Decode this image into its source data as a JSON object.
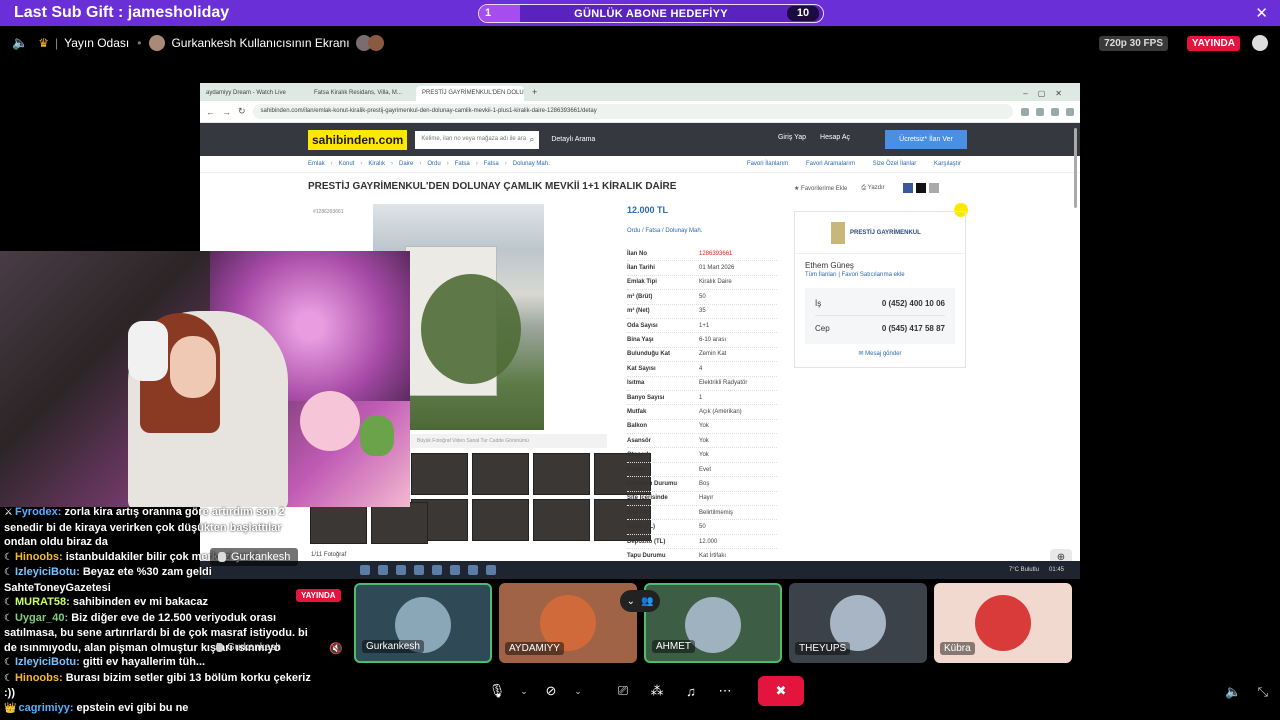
{
  "gift": {
    "title": "Last Sub Gift : jamesholiday",
    "goal_start": "1",
    "goal_label": "GÜNLÜK ABONE HEDEFİYY",
    "goal_end": "10",
    "goal_progress": 0.12
  },
  "room": {
    "name": "Yayın Odası",
    "screen_owner": "Gurkankesh Kullanıcısının Ekranı",
    "resolution": "720p 30 FPS",
    "live": "YAYINDA"
  },
  "browser": {
    "tabs": [
      "aydamiyy Dream - Watch Live",
      "Fatsa Kiralık Residans, Villa, M...",
      "PRESTİJ GAYRİMENKUL'DEN DOLU..."
    ],
    "url": "sahibinden.com/ilan/emlak-konut-kiralik-prestij-gayrimenkul-den-dolunay-camlik-mevkii-1-plus1-kiralik-daire-1286393661/detay"
  },
  "site": {
    "logo": "sahibinden.com",
    "search_placeholder": "Kelime, ilan no veya mağaza adı ile ara",
    "advanced": "Detaylı Arama",
    "login": "Giriş Yap",
    "register": "Hesap Aç",
    "cta": "Ücretsiz* İlan Ver",
    "crumbs": [
      "Emlak",
      "Konut",
      "Kiralık",
      "Daire",
      "Ordu",
      "Fatsa",
      "Fatsa",
      "Dolunay Mah."
    ],
    "crumb_right": [
      "Favori İlanlarım",
      "Favori Aramalarım",
      "Size Özel İlanlar",
      "Karşılaştır"
    ]
  },
  "listing": {
    "title": "PRESTİJ GAYRİMENKUL'DEN DOLUNAY ÇAMLIK MEVKİİ 1+1 KİRALIK DAİRE",
    "fav": "Favorilerime Ekle",
    "print": "Yazdır",
    "listing_no_small": "#1286393661",
    "photo_count": "1/11 Fotoğraf",
    "photo_tools": "Büyük Fotoğraf    Video    Sanal Tur    Cadde Görünümü",
    "price": "12.000 TL",
    "location": "Ordu  /  Fatsa  /  Dolunay Mah.",
    "attributes": [
      {
        "k": "İlan No",
        "v": "1286393661",
        "red": true
      },
      {
        "k": "İlan Tarihi",
        "v": "01 Mart 2026"
      },
      {
        "k": "Emlak Tipi",
        "v": "Kiralık Daire"
      },
      {
        "k": "m² (Brüt)",
        "v": "50"
      },
      {
        "k": "m² (Net)",
        "v": "35"
      },
      {
        "k": "Oda Sayısı",
        "v": "1+1"
      },
      {
        "k": "Bina Yaşı",
        "v": "6-10 arası"
      },
      {
        "k": "Bulunduğu Kat",
        "v": "Zemin Kat"
      },
      {
        "k": "Kat Sayısı",
        "v": "4"
      },
      {
        "k": "Isıtma",
        "v": "Elektrikli Radyatör"
      },
      {
        "k": "Banyo Sayısı",
        "v": "1"
      },
      {
        "k": "Mutfak",
        "v": "Açık (Amerikan)"
      },
      {
        "k": "Balkon",
        "v": "Yok"
      },
      {
        "k": "Asansör",
        "v": "Yok"
      },
      {
        "k": "Otopark",
        "v": "Yok"
      },
      {
        "k": "Eşyalı",
        "v": "Evet"
      },
      {
        "k": "Kullanım Durumu",
        "v": "Boş"
      },
      {
        "k": "Site İçerisinde",
        "v": "Hayır"
      },
      {
        "k": "Site Adı",
        "v": "Belirtilmemiş"
      },
      {
        "k": "Aidat (TL)",
        "v": "50"
      },
      {
        "k": "Depozito (TL)",
        "v": "12.000"
      },
      {
        "k": "Tapu Durumu",
        "v": "Kat İrtifakı"
      }
    ]
  },
  "seller": {
    "office": "PRESTİJ GAYRİMENKUL",
    "agent": "Ethem Güneş",
    "links": "Tüm İlanları  |  Favori Satıcılarıma ekle",
    "phones": [
      {
        "label": "İş",
        "num": "0 (452) 400 10 06"
      },
      {
        "label": "Cep",
        "num": "0 (545) 417 58 87"
      }
    ],
    "send": "Mesaj gönder"
  },
  "taskbar": {
    "weather": "7°C  Bulutlu",
    "clock": "01:45"
  },
  "cam": {
    "name": "Gurkankesh"
  },
  "chat": [
    {
      "badge": "⚔",
      "user": "Fyrodex:",
      "ucls": "u1",
      "text": "zorla kira artış oranına göre artırdım son 2 senedir bi de kiraya verirken çok düşükten başlattılar ondan oldu biraz da"
    },
    {
      "badge": "☾",
      "user": "Hinoobs:",
      "ucls": "u2",
      "text": "istanbuldakiler bilir çok merkezi yani"
    },
    {
      "badge": "☾",
      "user": "IzleyiciBotu:",
      "ucls": "u7",
      "text": "Beyaz ete %30 zam geldi SahteToneyGazetesi"
    },
    {
      "badge": "☾",
      "user": "MURAT58:",
      "ucls": "u4",
      "text": "sahibinden ev mi bakacaz"
    },
    {
      "badge": "☾",
      "user": "Uygar_40:",
      "ucls": "u5",
      "text": "Biz diğer eve de 12.500 veriyoduk orası satılmasa, bu sene artırırlardı bi de çok masraf istiyodu. bi de ısınmıyodu, alan pişman olmuştur kışları ısınmıyo"
    },
    {
      "badge": "☾",
      "user": "IzleyiciBotu:",
      "ucls": "u7",
      "text": "gitti ev hayallerim tüh..."
    },
    {
      "badge": "☾",
      "user": "Hinoobs:",
      "ucls": "u2",
      "text": "Burası bizim setler gibi 13 bölüm korku çekeriz :))"
    },
    {
      "badge": "👑",
      "user": "cagrimiyy:",
      "ucls": "u1",
      "text": "epstein evi gibi bu ne"
    }
  ],
  "chat_live": "YAYINDA",
  "chat_cam_label": "Gurkankesh",
  "participants": [
    {
      "name": "Gurkankesh",
      "speaking": true
    },
    {
      "name": "AYDAMIYY",
      "speaking": false
    },
    {
      "name": "AHMET",
      "speaking": true
    },
    {
      "name": "THEYUPS",
      "speaking": false
    },
    {
      "name": "Kübra",
      "speaking": false
    }
  ]
}
